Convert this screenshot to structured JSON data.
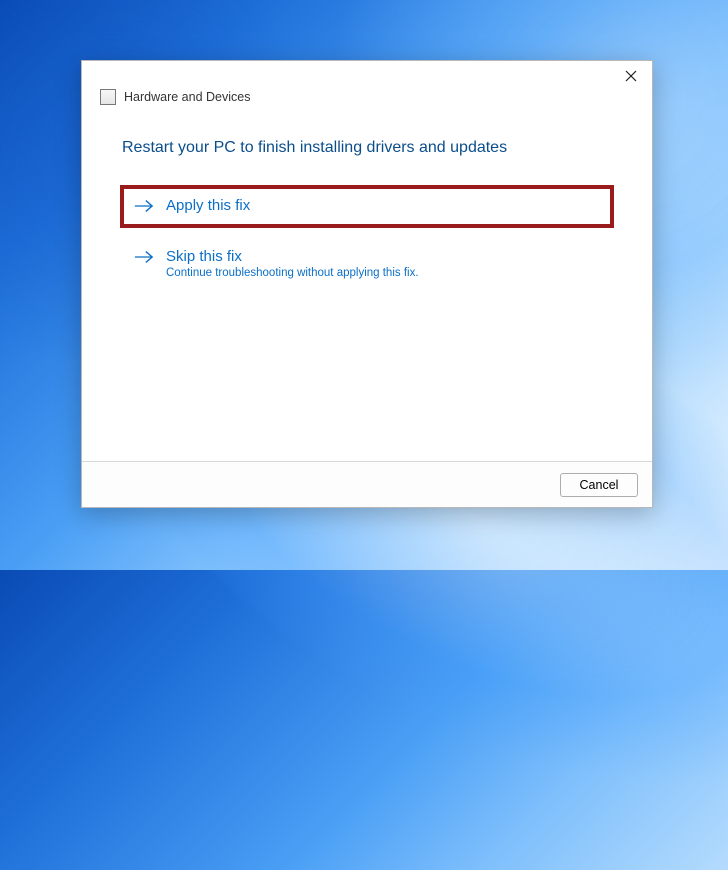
{
  "window": {
    "title": "Hardware and Devices"
  },
  "heading": "Restart your PC to finish installing drivers and updates",
  "options": {
    "apply": {
      "label": "Apply this fix"
    },
    "skip": {
      "label": "Skip this fix",
      "sub": "Continue troubleshooting without applying this fix."
    }
  },
  "footer": {
    "cancel": "Cancel"
  },
  "highlight_color": "#9a1b1b",
  "accent_color": "#0b6fc7"
}
